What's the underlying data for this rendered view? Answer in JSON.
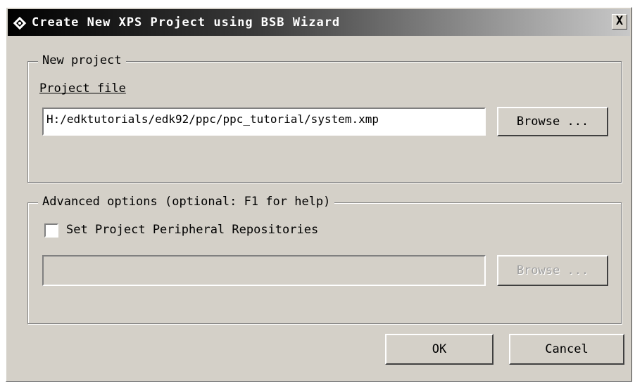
{
  "window": {
    "title": "Create New XPS Project using BSB Wizard",
    "close_label": "X"
  },
  "new_project": {
    "legend": "New project",
    "project_file_label": "Project file",
    "project_file_value": "H:/edktutorials/edk92/ppc/ppc_tutorial/system.xmp",
    "browse_label": "Browse ..."
  },
  "advanced": {
    "legend": "Advanced options (optional: F1 for help)",
    "checkbox_label": "Set Project Peripheral Repositories",
    "checkbox_checked": false,
    "repository_value": "",
    "browse_label": "Browse ...",
    "browse_enabled": false
  },
  "footer": {
    "ok_label": "OK",
    "cancel_label": "Cancel"
  }
}
